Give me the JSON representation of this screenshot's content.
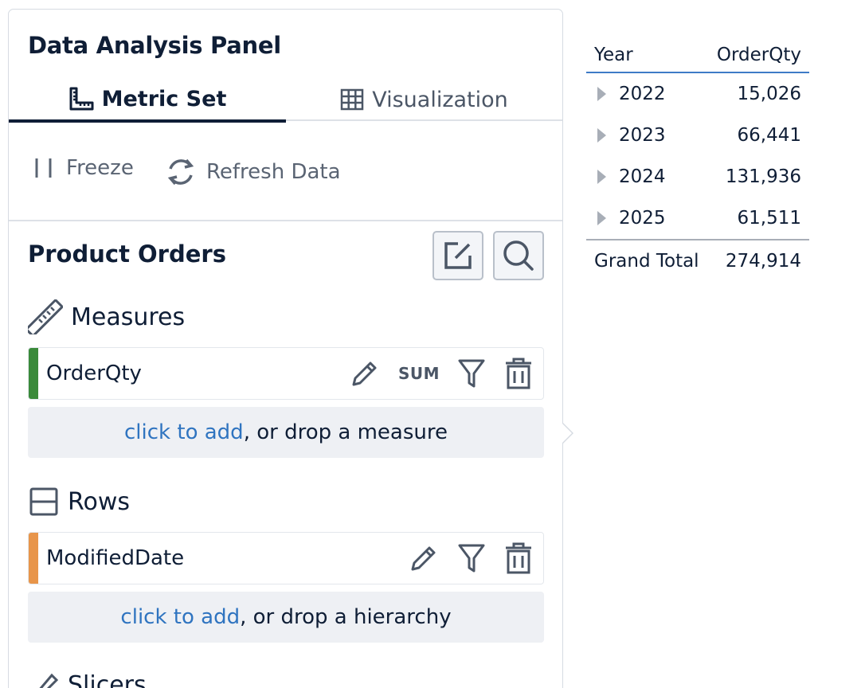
{
  "panel": {
    "title": "Data Analysis Panel",
    "tabs": [
      {
        "label": "Metric Set",
        "icon": "ruler-square-icon",
        "active": true
      },
      {
        "label": "Visualization",
        "icon": "grid-icon",
        "active": false
      }
    ],
    "toolbar": {
      "freeze_label": "Freeze",
      "refresh_label": "Refresh Data"
    },
    "dataset_title": "Product Orders",
    "measures": {
      "label": "Measures",
      "fields": [
        {
          "name": "OrderQty",
          "aggregation": "SUM",
          "color": "#3a8a3a"
        }
      ],
      "dropzone": {
        "link": "click to add",
        "rest": ", or drop a measure"
      }
    },
    "rows": {
      "label": "Rows",
      "fields": [
        {
          "name": "ModifiedDate",
          "color": "#e8954a"
        }
      ],
      "dropzone": {
        "link": "click to add",
        "rest": ", or drop a hierarchy"
      }
    },
    "slicers": {
      "label": "Slicers"
    }
  },
  "result_table": {
    "headers": [
      "Year",
      "OrderQty"
    ],
    "rows": [
      {
        "year": "2022",
        "value": "15,026"
      },
      {
        "year": "2023",
        "value": "66,441"
      },
      {
        "year": "2024",
        "value": "131,936"
      },
      {
        "year": "2025",
        "value": "61,511"
      }
    ],
    "total_label": "Grand Total",
    "total_value": "274,914"
  },
  "colors": {
    "accent_blue": "#2f74c0",
    "text_dark": "#0f1e36"
  }
}
